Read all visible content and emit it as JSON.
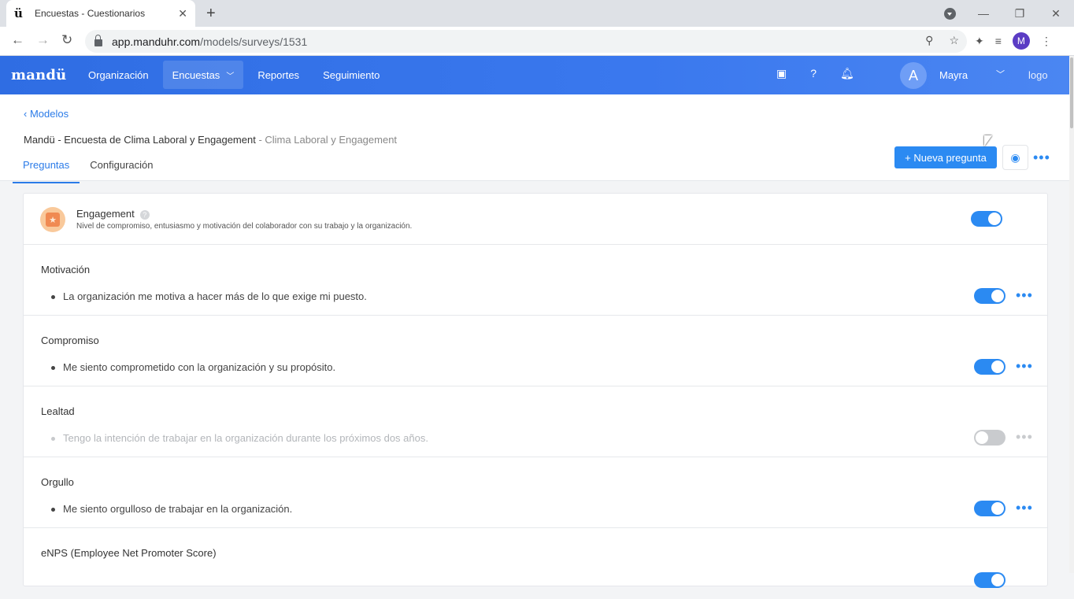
{
  "browser": {
    "tab_title": "Encuestas - Cuestionarios",
    "tab_favicon": "ü",
    "url_host": "app.manduhr.com",
    "url_path": "/models/surveys/1531",
    "profile_initial": "M"
  },
  "header": {
    "brand": "mandü",
    "nav": [
      "Organización",
      "Encuestas",
      "Reportes",
      "Seguimiento"
    ],
    "active_nav": "Encuestas",
    "user_initial": "A",
    "user_name": "Mayra",
    "logo_alt": "logo"
  },
  "page": {
    "breadcrumb": "Modelos",
    "title": "Mandü - Encuesta de Clima Laboral y Engagement",
    "subtitle": " - Clima Laboral y Engagement",
    "tabs": [
      "Preguntas",
      "Configuración"
    ],
    "active_tab": "Preguntas",
    "new_question_label": "+ Nueva pregunta"
  },
  "category": {
    "title": "Engagement",
    "description": "Nivel de compromiso, entusiasmo y motivación del colaborador con su trabajo y la organización.",
    "enabled": true,
    "icon": "star-ribbon-icon"
  },
  "questions": [
    {
      "title": "Motivación",
      "text": "La organización me motiva a hacer más de lo que exige mi puesto.",
      "enabled": true
    },
    {
      "title": "Compromiso",
      "text": "Me siento comprometido con la organización y su propósito.",
      "enabled": true
    },
    {
      "title": "Lealtad",
      "text": "Tengo la intención de trabajar en la organización durante los próximos dos años.",
      "enabled": false
    },
    {
      "title": "Orgullo",
      "text": "Me siento orgulloso de trabajar en la organización.",
      "enabled": true
    },
    {
      "title": "eNPS (Employee Net Promoter Score)",
      "text": "",
      "enabled": true
    }
  ],
  "colors": {
    "primary": "#2b8af2",
    "header_start": "#2f6de3",
    "toggle_off": "#c9cbce"
  }
}
